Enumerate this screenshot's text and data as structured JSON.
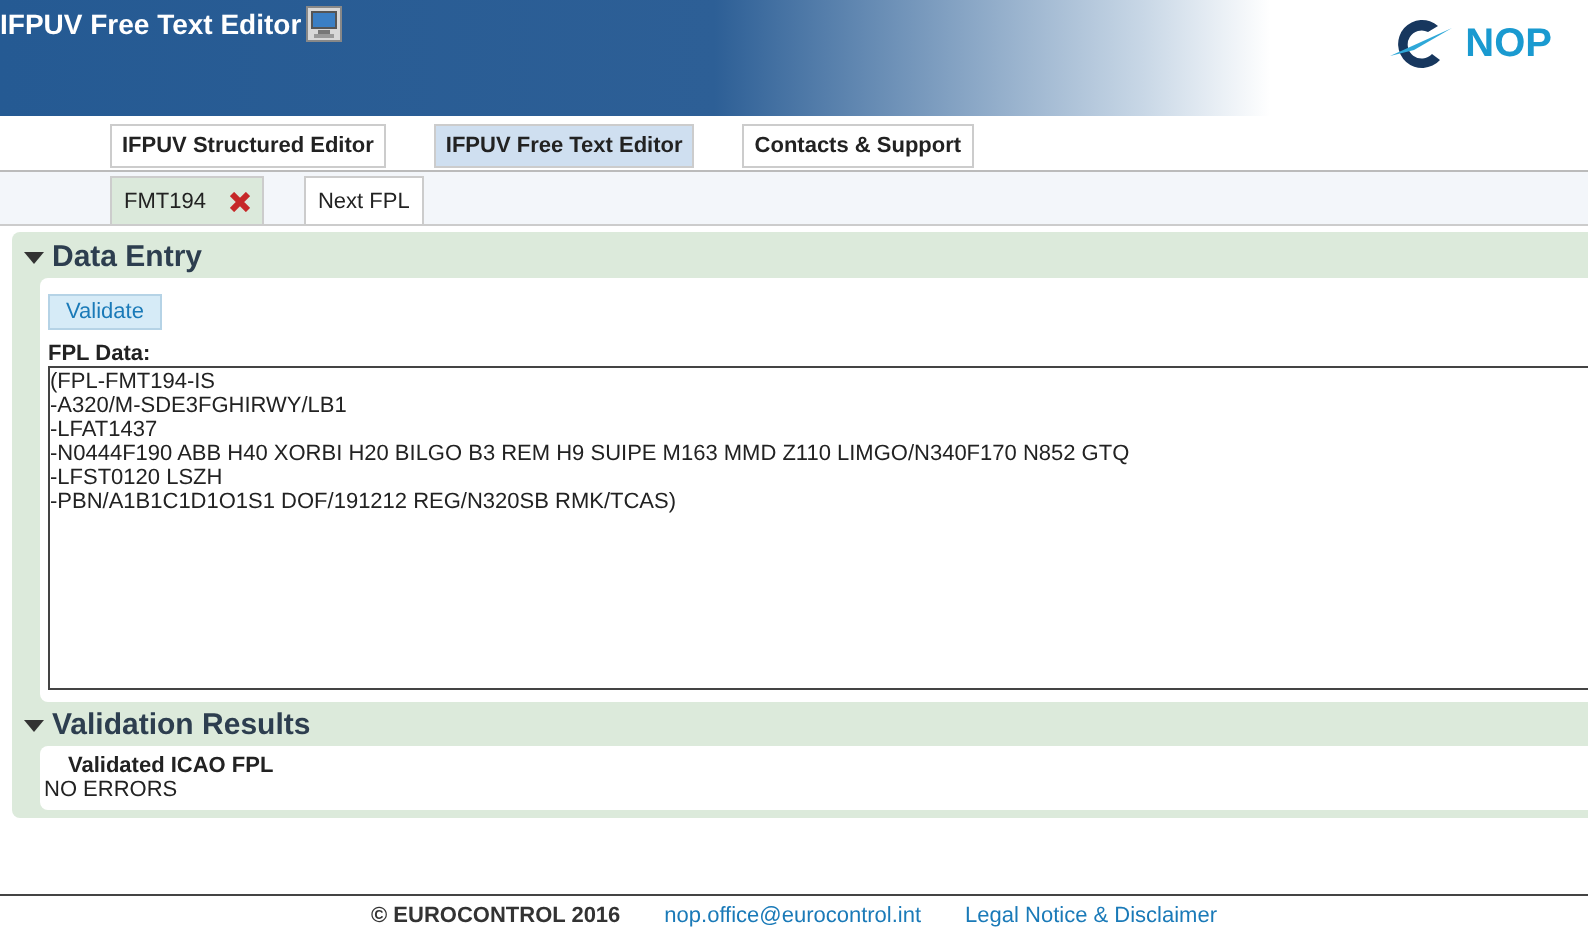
{
  "header": {
    "title": "IFPUV Free Text Editor",
    "logo_text": "NOP"
  },
  "tabs": [
    {
      "label": "IFPUV Structured Editor",
      "selected": false
    },
    {
      "label": "IFPUV Free Text Editor",
      "selected": true
    },
    {
      "label": "Contacts & Support",
      "selected": false
    }
  ],
  "flight_tabs": [
    {
      "label": "FMT194",
      "selected": true,
      "closable": true
    },
    {
      "label": "Next FPL",
      "selected": false,
      "closable": false
    }
  ],
  "data_entry": {
    "title": "Data Entry",
    "expanded": true,
    "validate_button": "Validate",
    "field_label": "FPL Data:",
    "fpl_lines": [
      "(FPL-FMT194-IS",
      "-A320/M-SDE3FGHIRWY/LB1",
      "-LFAT1437",
      "-N0444F190 ABB H40 XORBI H20 BILGO B3 REM H9 SUIPE M163 MMD Z110 LIMGO/N340F170 N852 GTQ",
      "-LFST0120 LSZH",
      "-PBN/A1B1C1D1O1S1 DOF/191212 REG/N320SB RMK/TCAS)"
    ]
  },
  "validation": {
    "title": "Validation Results",
    "expanded": true,
    "heading": "Validated ICAO FPL",
    "result": "NO ERRORS"
  },
  "footer": {
    "copyright": "© EUROCONTROL 2016",
    "email": "nop.office@eurocontrol.int",
    "legal": "Legal Notice & Disclaimer"
  }
}
